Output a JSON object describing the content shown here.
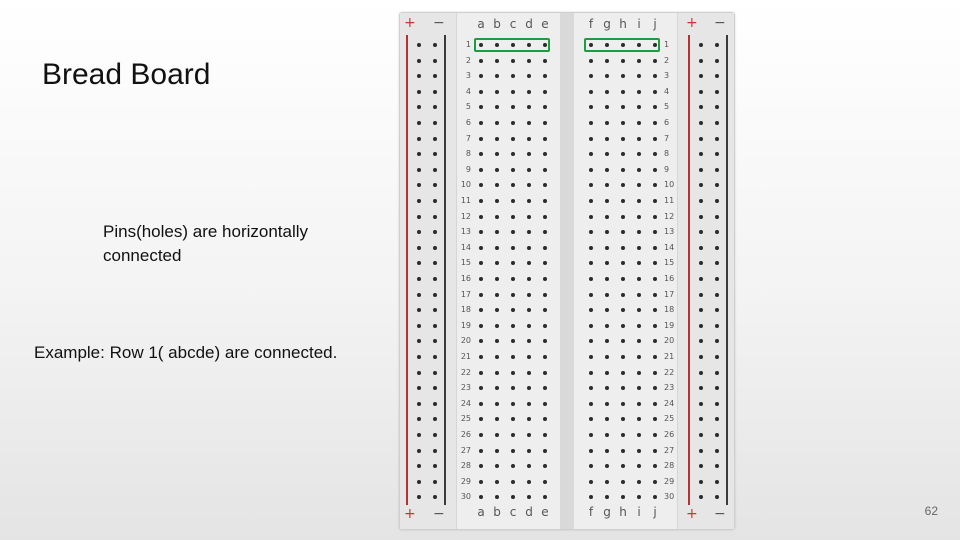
{
  "slide": {
    "title": "Bread Board",
    "note1": "Pins(holes) are horizontally connected",
    "note2": "Example: Row 1( abcde) are connected.",
    "page_number": "62"
  },
  "breadboard": {
    "rows": 30,
    "left_columns": [
      "a",
      "b",
      "c",
      "d",
      "e"
    ],
    "right_columns": [
      "f",
      "g",
      "h",
      "i",
      "j"
    ],
    "rail_labels": {
      "plus": "+",
      "minus": "−"
    },
    "highlighted_row": 1,
    "highlight_color": "#1a9e3f",
    "rail_plus_color": "#b33333",
    "rail_minus_color": "#3a3a3a"
  }
}
